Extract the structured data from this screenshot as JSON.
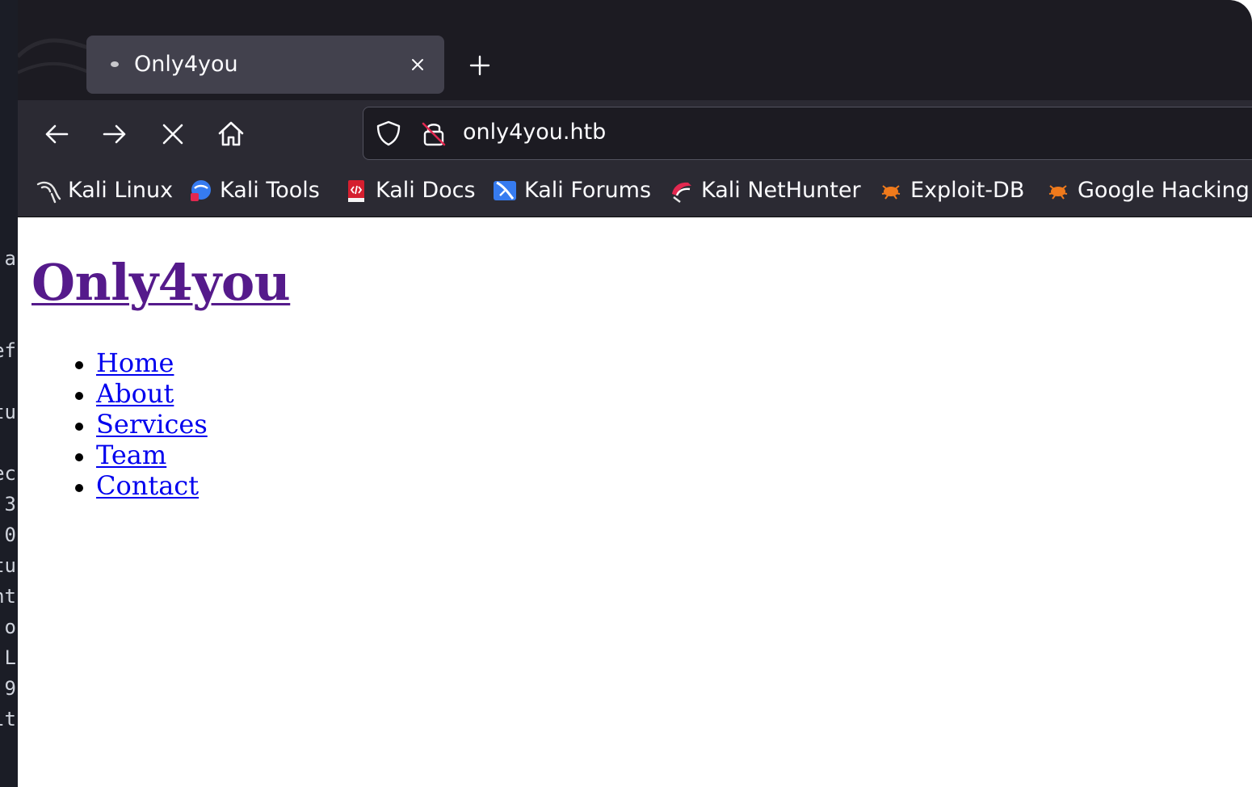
{
  "terminal": {
    "fragments": [
      "a",
      "ef",
      "tu",
      "ec",
      "3",
      "0",
      "tu",
      "nt",
      "o",
      "L",
      "9",
      "lt"
    ]
  },
  "browser": {
    "tab": {
      "title": "Only4you",
      "close_icon": "close-icon"
    },
    "new_tab_icon": "plus-icon",
    "nav": {
      "back_icon": "arrow-left-icon",
      "forward_icon": "arrow-right-icon",
      "stop_icon": "close-icon",
      "home_icon": "home-icon"
    },
    "urlbar": {
      "url": "only4you.htb",
      "shield_icon": "tracking-protection-shield-icon",
      "lock_icon": "insecure-lock-icon"
    },
    "bookmarks": [
      {
        "label": "Kali Linux",
        "icon": "kali-dragon-icon"
      },
      {
        "label": "Kali Tools",
        "icon": "kali-tools-icon"
      },
      {
        "label": "Kali Docs",
        "icon": "kali-docs-icon"
      },
      {
        "label": "Kali Forums",
        "icon": "kali-forums-icon"
      },
      {
        "label": "Kali NetHunter",
        "icon": "kali-nethunter-icon"
      },
      {
        "label": "Exploit-DB",
        "icon": "exploit-db-icon"
      },
      {
        "label": "Google Hacking",
        "icon": "exploit-db-icon"
      }
    ]
  },
  "page": {
    "title": "Only4you",
    "nav_links": [
      "Home",
      "About",
      "Services",
      "Team",
      "Contact"
    ]
  },
  "colors": {
    "visited_link": "#551a8b",
    "link": "#0000ee",
    "toolbar": "#2b2a33",
    "tabbar": "#1c1b22",
    "active_tab": "#42414d"
  }
}
